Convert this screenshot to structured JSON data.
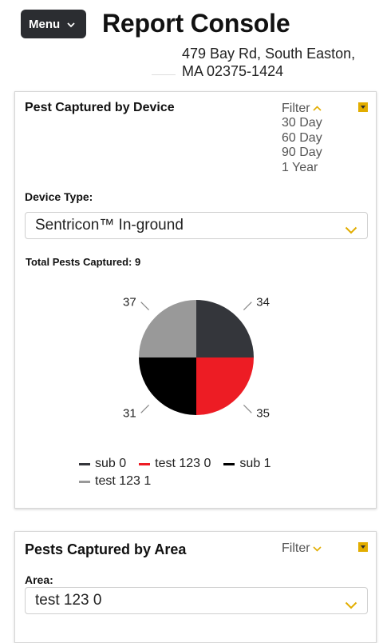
{
  "header": {
    "menu_label": "Menu",
    "title": "Report Console",
    "address_line1": "479 Bay Rd, South Easton,",
    "address_line2": "MA 02375-1424"
  },
  "pest_by_device": {
    "title": "Pest Captured by Device",
    "filter_label": "Filter",
    "filter_options": [
      "30 Day",
      "60 Day",
      "90 Day",
      "1 Year"
    ],
    "device_type_label": "Device Type:",
    "device_type_value": "Sentricon™ In-ground",
    "total_label": "Total Pests Captured: 9"
  },
  "chart_data": {
    "type": "pie",
    "title": "",
    "series": [
      {
        "name": "sub 0",
        "value": 25,
        "slice_label": "34",
        "color": "#34363b"
      },
      {
        "name": "test 123 0",
        "value": 25,
        "slice_label": "35",
        "color": "#ed1c24"
      },
      {
        "name": "sub 1",
        "value": 25,
        "slice_label": "31",
        "color": "#000000"
      },
      {
        "name": "test 123 1",
        "value": 25,
        "slice_label": "37",
        "color": "#999999"
      }
    ],
    "legend_position": "bottom"
  },
  "pest_by_area": {
    "title": "Pests Captured by Area",
    "filter_label": "Filter",
    "area_label": "Area:",
    "area_value": "test 123 0"
  },
  "colors": {
    "accent": "#e2ad00",
    "menu_bg": "#2b2d31"
  }
}
